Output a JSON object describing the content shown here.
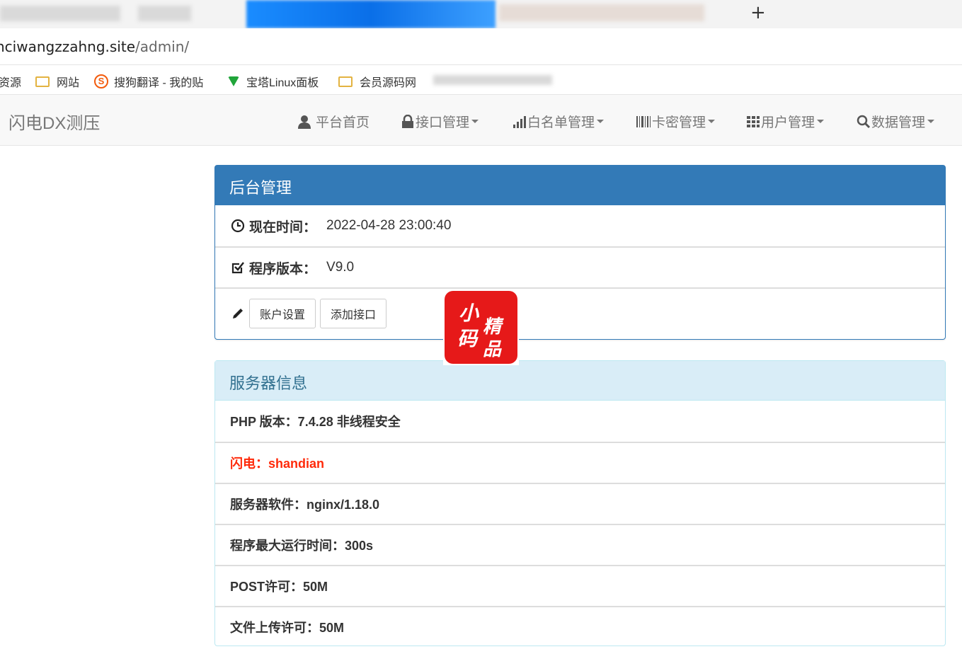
{
  "browser": {
    "address": {
      "host": "nciwangzzahng.site",
      "path": "/admin/"
    },
    "new_tab": "+",
    "bookmarks": [
      {
        "label": "资源"
      },
      {
        "label": "网站"
      },
      {
        "label": "搜狗翻译 - 我的贴"
      },
      {
        "label": "宝塔Linux面板"
      },
      {
        "label": "会员源码网"
      }
    ]
  },
  "navbar": {
    "brand": "闪电DX测压",
    "items": [
      {
        "icon": "user-icon",
        "label": "平台首页"
      },
      {
        "icon": "lock-icon",
        "label": "接口管理"
      },
      {
        "icon": "signal-icon",
        "label": "白名单管理"
      },
      {
        "icon": "barcode-icon",
        "label": "卡密管理"
      },
      {
        "icon": "grid-icon",
        "label": "用户管理"
      },
      {
        "icon": "search-icon",
        "label": "数据管理"
      }
    ]
  },
  "admin_panel": {
    "title": "后台管理",
    "time_label": "现在时间：",
    "time_value": "2022-04-28 23:00:40",
    "version_label": "程序版本：",
    "version_value": "V9.0",
    "buttons": {
      "account": "账户设置",
      "add_api": "添加接口"
    }
  },
  "server_panel": {
    "title": "服务器信息",
    "rows": [
      "PHP 版本：7.4.28 非线程安全",
      "闪电：shandian",
      "服务器软件：nginx/1.18.0",
      "程序最大运行时间：300s",
      "POST许可：50M",
      "文件上传许可：50M"
    ]
  },
  "seal": {
    "chars": [
      "小",
      "精",
      "码",
      "品"
    ]
  },
  "colors": {
    "primary": "#337ab7",
    "info_bg": "#d9edf7",
    "info_text": "#31708f",
    "danger": "#ff2a0a"
  }
}
